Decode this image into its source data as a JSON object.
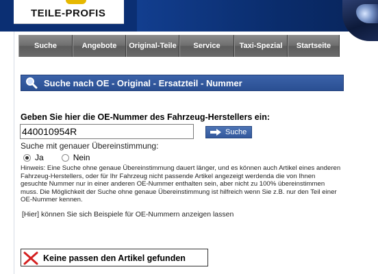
{
  "header": {
    "logo_text": "TEILE-PROFIS"
  },
  "nav": {
    "items": [
      {
        "label": "Suche"
      },
      {
        "label": "Angebote"
      },
      {
        "label": "Original-Teile"
      },
      {
        "label": "Service"
      },
      {
        "label": "Taxi-Spezial"
      },
      {
        "label": "Startseite"
      }
    ]
  },
  "section": {
    "title": "Suche nach OE - Original - Ersatzteil - Nummer",
    "icon": "magnifier-icon"
  },
  "form": {
    "prompt": "Geben Sie hier die OE-Nummer des Fahrzeug-Herstellers ein:",
    "oe_number_value": "440010954R",
    "search_button_label": "Suche",
    "exact_match_label": "Suche mit genauer Übereinstimmung:",
    "radio_yes_label": "Ja",
    "radio_no_label": "Nein",
    "selected_option": "Ja",
    "hint": "Hinweis: Eine Suche ohne genaue Übereinstimmung dauert länger, und es können auch Artikel eines anderen Fahrzeug-Herstellers, oder für Ihr Fahrzeug nicht passende Artikel angezeigt werdenda die von Ihnen gesuchte Nummer nur in einer anderen OE-Nummer enthalten sein, aber nicht zu 100% übereinstimmen muss. Die Möglichkeit der Suche ohne genaue Übereinstimmung ist hilfreich wenn Sie z.B. nur den Teil einer OE-Nummer kennen.",
    "examples_text": "[Hier] können Sie sich Beispiele für OE-Nummern anzeigen lassen"
  },
  "result": {
    "message": "Keine passen den Artikel gefunden",
    "icon": "red-x-icon"
  },
  "colors": {
    "header_bg": "#0b2f73",
    "title_bar": "#2a4f93",
    "nav_gray": "#6e6e6e",
    "error_red": "#d42020"
  }
}
